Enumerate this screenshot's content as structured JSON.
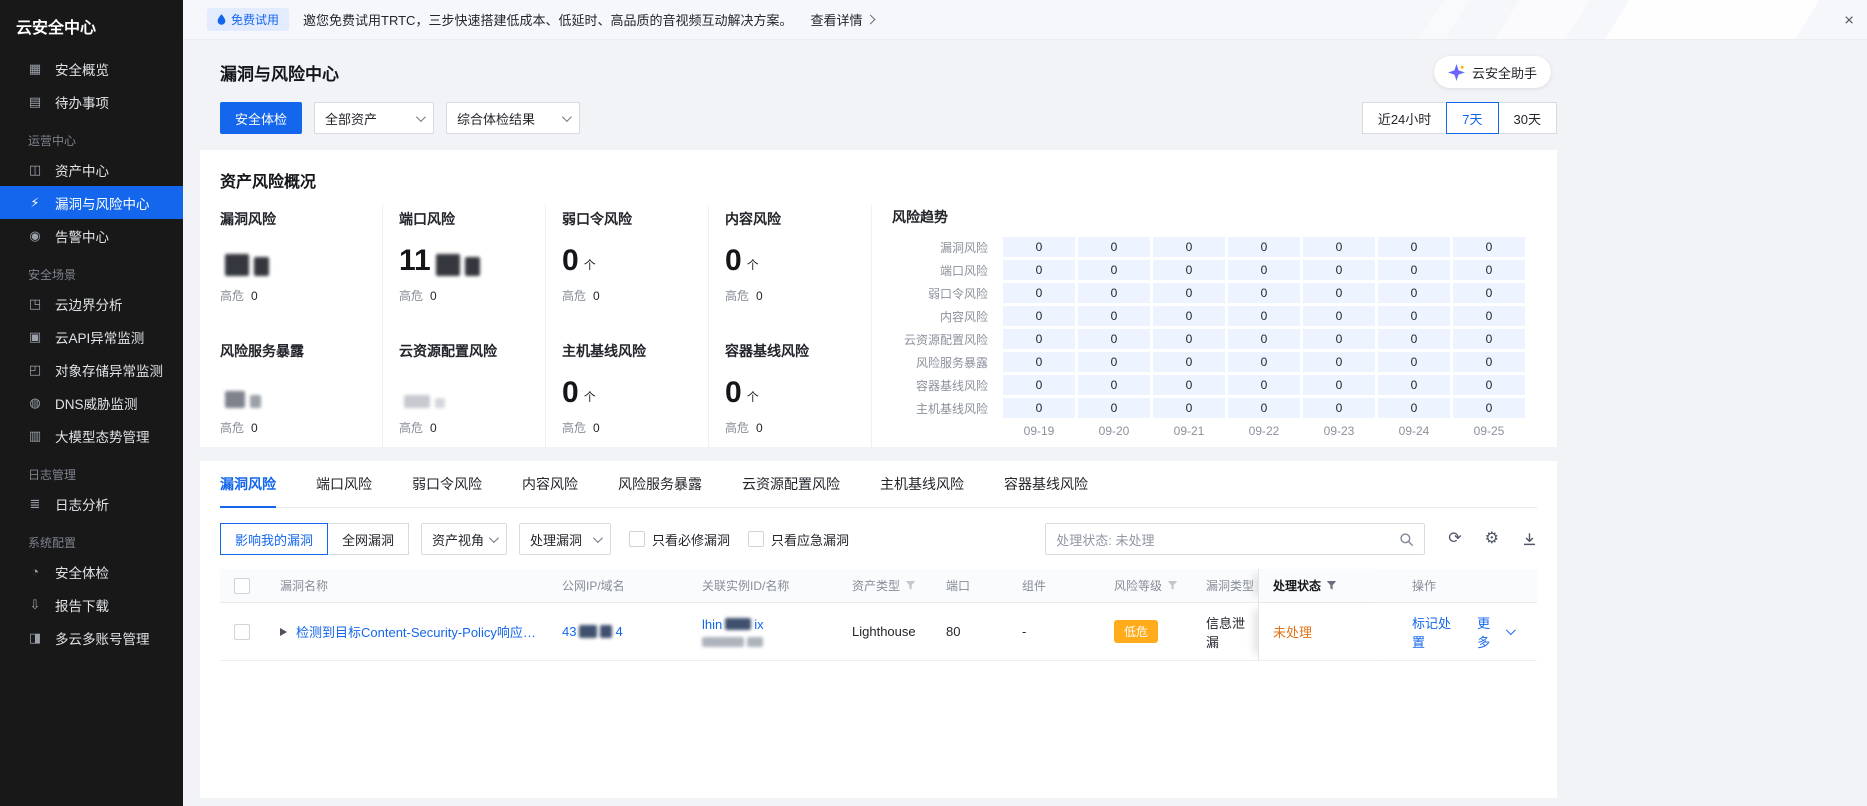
{
  "colors": {
    "accent": "#1467ec",
    "sidebar_bg": "#181818",
    "low_risk_badge": "#ffab1a",
    "status_unprocessed": "#e37318",
    "trend_cell_bg": "#edf4ff"
  },
  "icons": {
    "close": "×",
    "refresh": "⟳",
    "gear": "⚙"
  },
  "sidebar": {
    "title": "云安全中心",
    "items": [
      {
        "label": "安全概览",
        "glyph": "▦",
        "icon_name": "overview-icon"
      },
      {
        "label": "待办事项",
        "glyph": "▤",
        "icon_name": "todo-icon"
      },
      {
        "type": "section",
        "label": "运营中心"
      },
      {
        "label": "资产中心",
        "glyph": "◫",
        "icon_name": "asset-center-icon"
      },
      {
        "label": "漏洞与风险中心",
        "glyph": "⚡",
        "icon_name": "vuln-risk-center-icon",
        "active": true
      },
      {
        "label": "告警中心",
        "glyph": "◉",
        "icon_name": "alert-center-icon"
      },
      {
        "type": "section",
        "label": "安全场景"
      },
      {
        "label": "云边界分析",
        "glyph": "◳",
        "icon_name": "cloud-boundary-icon"
      },
      {
        "label": "云API异常监测",
        "glyph": "▣",
        "icon_name": "api-anomaly-icon"
      },
      {
        "label": "对象存储异常监测",
        "glyph": "◰",
        "icon_name": "storage-anomaly-icon"
      },
      {
        "label": "DNS威胁监测",
        "glyph": "◍",
        "icon_name": "dns-threat-icon"
      },
      {
        "label": "大模型态势管理",
        "glyph": "▥",
        "icon_name": "llm-posture-icon"
      },
      {
        "type": "section",
        "label": "日志管理"
      },
      {
        "label": "日志分析",
        "glyph": "≣",
        "icon_name": "log-analysis-icon"
      },
      {
        "type": "section",
        "label": "系统配置"
      },
      {
        "label": "安全体检",
        "glyph": "◔",
        "icon_name": "security-check-icon"
      },
      {
        "label": "报告下载",
        "glyph": "⇩",
        "icon_name": "report-download-icon"
      },
      {
        "label": "多云多账号管理",
        "glyph": "◨",
        "icon_name": "multicloud-account-icon"
      }
    ]
  },
  "banner": {
    "badge": "免费试用",
    "message": "邀您免费试用TRTC，三步快速搭建低成本、低延时、高品质的音视频互动解决方案。",
    "link": "查看详情"
  },
  "header": {
    "title": "漏洞与风险中心",
    "assistant_label": "云安全助手"
  },
  "filters": {
    "check_button": "安全体检",
    "asset_select": "全部资产",
    "result_select": "综合体检结果",
    "ranges": [
      "近24小时",
      "7天",
      "30天"
    ],
    "active_range": "7天"
  },
  "overview": {
    "title": "资产风险概况",
    "high_label": "高危",
    "unit": "个",
    "cards": [
      {
        "label": "漏洞风险",
        "redacted": true,
        "redacted_style": "dark",
        "high": "0"
      },
      {
        "label": "端口风险",
        "visible_part": "11",
        "redacted": true,
        "redacted_style": "dark",
        "high": "0"
      },
      {
        "label": "弱口令风险",
        "value": "0",
        "high": "0"
      },
      {
        "label": "内容风险",
        "value": "0",
        "high": "0"
      },
      {
        "label": "风险服务暴露",
        "redacted": true,
        "redacted_style": "gray",
        "high": "0"
      },
      {
        "label": "云资源配置风险",
        "redacted": true,
        "redacted_style": "light",
        "high": "0"
      },
      {
        "label": "主机基线风险",
        "value": "0",
        "high": "0"
      },
      {
        "label": "容器基线风险",
        "value": "0",
        "high": "0"
      }
    ],
    "trend": {
      "title": "风险趋势",
      "row_labels": [
        "漏洞风险",
        "端口风险",
        "弱口令风险",
        "内容风险",
        "云资源配置风险",
        "风险服务暴露",
        "容器基线风险",
        "主机基线风险"
      ],
      "dates": [
        "09-19",
        "09-20",
        "09-21",
        "09-22",
        "09-23",
        "09-24",
        "09-25"
      ],
      "values": [
        [
          0,
          0,
          0,
          0,
          0,
          0,
          0
        ],
        [
          0,
          0,
          0,
          0,
          0,
          0,
          0
        ],
        [
          0,
          0,
          0,
          0,
          0,
          0,
          0
        ],
        [
          0,
          0,
          0,
          0,
          0,
          0,
          0
        ],
        [
          0,
          0,
          0,
          0,
          0,
          0,
          0
        ],
        [
          0,
          0,
          0,
          0,
          0,
          0,
          0
        ],
        [
          0,
          0,
          0,
          0,
          0,
          0,
          0
        ],
        [
          0,
          0,
          0,
          0,
          0,
          0,
          0
        ]
      ]
    }
  },
  "tabs": {
    "items": [
      "漏洞风险",
      "端口风险",
      "弱口令风险",
      "内容风险",
      "风险服务暴露",
      "云资源配置风险",
      "主机基线风险",
      "容器基线风险"
    ],
    "active": "漏洞风险"
  },
  "toolbar": {
    "scope_my": "影响我的漏洞",
    "scope_all": "全网漏洞",
    "view_select": "资产视角",
    "handle_select": "处理漏洞",
    "checkbox_required": "只看必修漏洞",
    "checkbox_emergency": "只看应急漏洞",
    "search_value": "处理状态: 未处理"
  },
  "table": {
    "columns": [
      "漏洞名称",
      "公网IP/域名",
      "关联实例ID/名称",
      "资产类型",
      "端口",
      "组件",
      "风险等级",
      "漏洞类型",
      "处理状态",
      "操作"
    ],
    "rows": [
      {
        "name": "检测到目标Content-Security-Policy响应头缺...",
        "ip_prefix": "43",
        "ip_suffix": "4",
        "instance_id_prefix": "lhin",
        "instance_id_suffix": "ix",
        "asset_type": "Lighthouse",
        "port": "80",
        "component": "-",
        "risk_level": "低危",
        "vuln_type": "信息泄漏",
        "status": "未处理",
        "action_mark": "标记处置",
        "action_more": "更多"
      }
    ]
  }
}
